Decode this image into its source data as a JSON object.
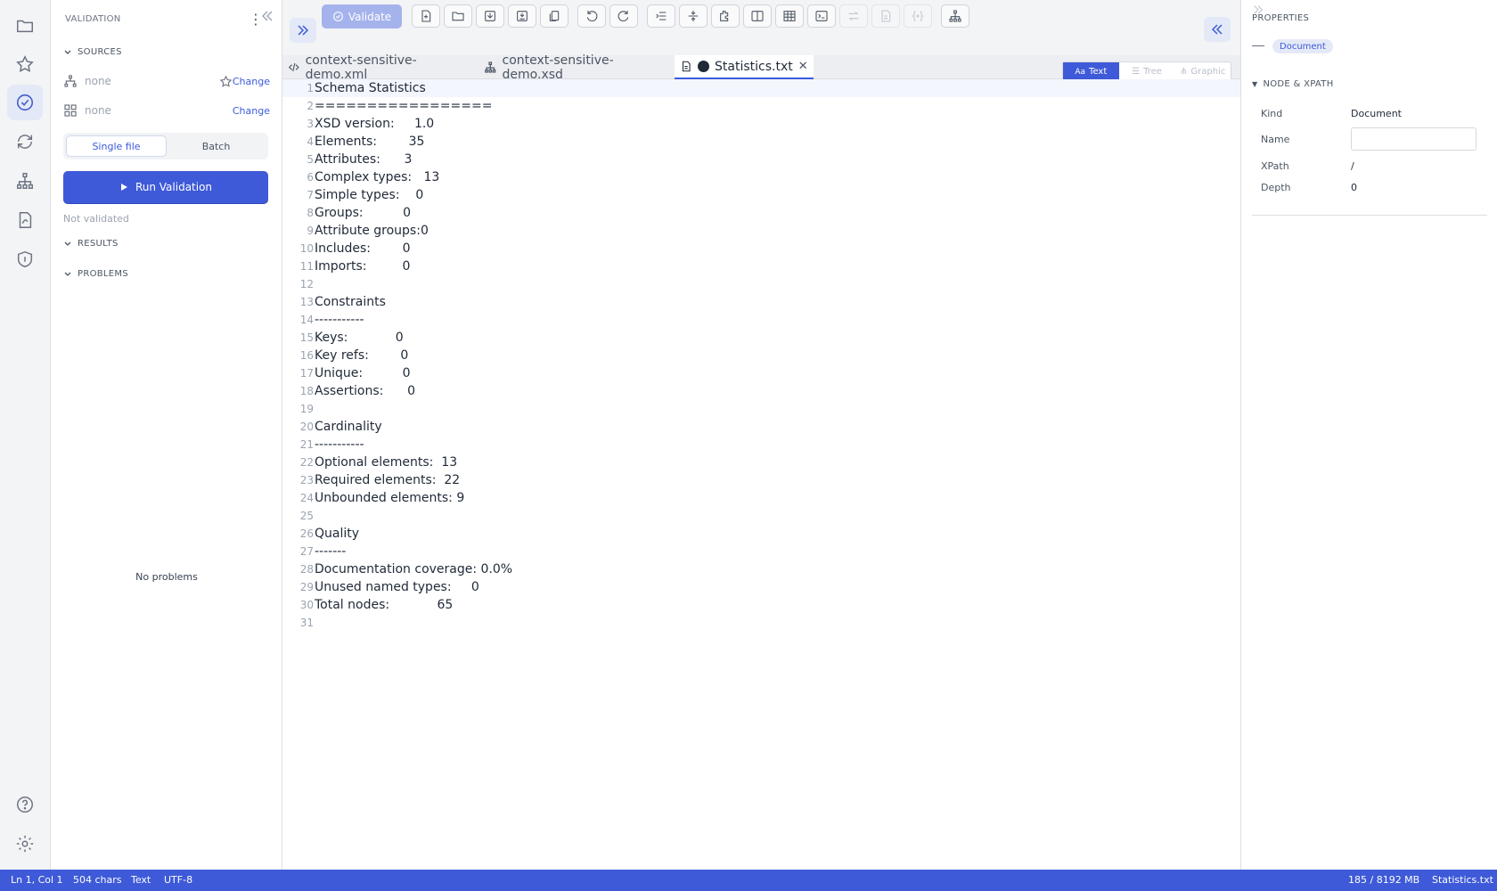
{
  "sidebar": {
    "title": "VALIDATION",
    "sources_header": "SOURCES",
    "sources": [
      {
        "label": "none",
        "change": "Change"
      },
      {
        "label": "none",
        "change": "Change"
      }
    ],
    "mode_single": "Single file",
    "mode_batch": "Batch",
    "run_label": "Run Validation",
    "state": "Not validated",
    "results_header": "RESULTS",
    "problems_header": "PROBLEMS",
    "no_problems": "No problems"
  },
  "toolbar": {
    "validate_label": "Validate"
  },
  "tabs": [
    {
      "label": "context-sensitive-demo.xml",
      "icon": "code-icon"
    },
    {
      "label": "context-sensitive-demo.xsd",
      "icon": "hierarchy-icon"
    },
    {
      "label": "Statistics.txt",
      "icon": "file-icon",
      "active": true,
      "modified": true
    }
  ],
  "view_modes": {
    "text": "Text",
    "tree": "Tree",
    "graphic": "Graphic",
    "text_prefix": "Aa"
  },
  "editor": {
    "lines": [
      "Schema Statistics",
      "=================",
      "XSD version:     1.0",
      "Elements:        35",
      "Attributes:      3",
      "Complex types:   13",
      "Simple types:    0",
      "Groups:          0",
      "Attribute groups:0",
      "Includes:        0",
      "Imports:         0",
      "",
      "Constraints",
      "-----------",
      "Keys:            0",
      "Key refs:        0",
      "Unique:          0",
      "Assertions:      0",
      "",
      "Cardinality",
      "-----------",
      "Optional elements:  13",
      "Required elements:  22",
      "Unbounded elements: 9",
      "",
      "Quality",
      "-------",
      "Documentation coverage: 0.0%",
      "Unused named types:     0",
      "Total nodes:            65",
      ""
    ]
  },
  "properties": {
    "title": "PROPERTIES",
    "badge": "Document",
    "section": "NODE & XPATH",
    "kind_label": "Kind",
    "kind_value": "Document",
    "name_label": "Name",
    "name_value": "",
    "xpath_label": "XPath",
    "xpath_value": "/",
    "depth_label": "Depth",
    "depth_value": "0"
  },
  "status": {
    "position": "Ln 1, Col 1",
    "chars": "504 chars",
    "mode": "Text",
    "encoding": "UTF-8",
    "memory": "185 / 8192 MB",
    "file": "Statistics.txt"
  },
  "colors": {
    "accent": "#3e5ad8",
    "accent_light": "#e4e9f7"
  }
}
